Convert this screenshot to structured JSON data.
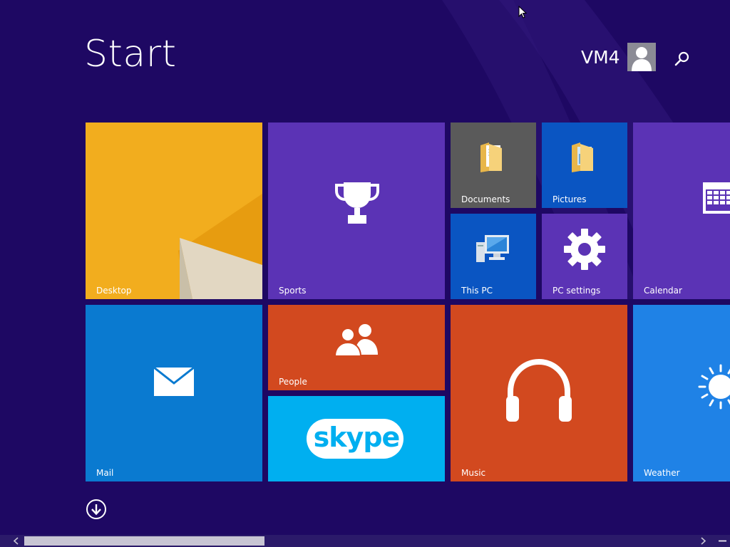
{
  "header": {
    "title": "Start",
    "user_name": "VM4"
  },
  "tiles": [
    {
      "id": "desktop",
      "label": "Desktop"
    },
    {
      "id": "sports",
      "label": "Sports"
    },
    {
      "id": "documents",
      "label": "Documents"
    },
    {
      "id": "pictures",
      "label": "Pictures"
    },
    {
      "id": "calendar",
      "label": "Calendar"
    },
    {
      "id": "this-pc",
      "label": "This PC"
    },
    {
      "id": "pc-settings",
      "label": "PC settings"
    },
    {
      "id": "mail",
      "label": "Mail"
    },
    {
      "id": "people",
      "label": "People"
    },
    {
      "id": "skype",
      "label": "skype"
    },
    {
      "id": "music",
      "label": "Music"
    },
    {
      "id": "weather",
      "label": "Weather"
    }
  ],
  "colors": {
    "background": "#1e0863",
    "desktop": "#f0a818",
    "sports": "#5b33b5",
    "documents": "#5a5a5a",
    "pictures": "#0a55c2",
    "calendar": "#5b33b5",
    "this_pc": "#0a55c2",
    "pc_settings": "#5b33b5",
    "mail": "#0a7ad0",
    "people": "#d2491f",
    "skype": "#00aff0",
    "music": "#d2491f",
    "weather": "#1f82e6"
  },
  "icons": {
    "sports": "trophy-icon",
    "documents": "folder-icon",
    "pictures": "folder-icon",
    "calendar": "calendar-icon",
    "this_pc": "computer-icon",
    "pc_settings": "gear-icon",
    "mail": "envelope-icon",
    "people": "people-icon",
    "music": "headphones-icon",
    "weather": "sun-icon",
    "apps": "down-arrow-icon",
    "search": "search-icon"
  }
}
